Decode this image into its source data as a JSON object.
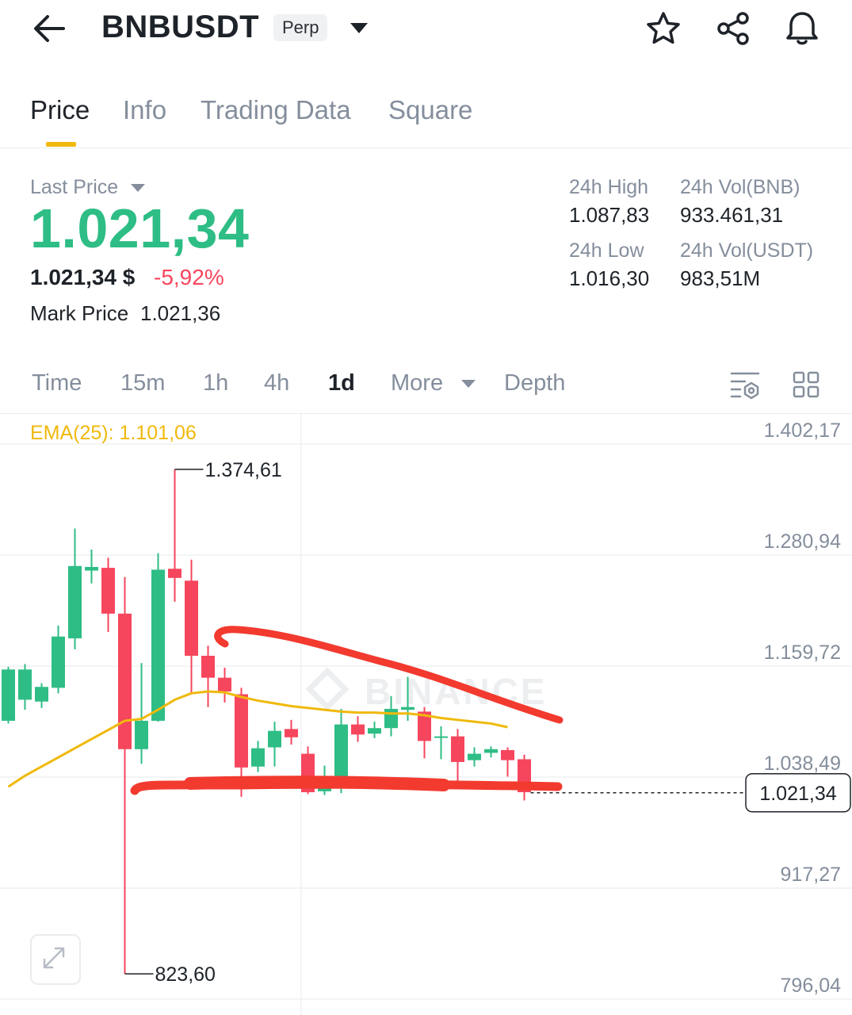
{
  "header": {
    "symbol": "BNBUSDT",
    "badge": "Perp",
    "icons": [
      "back-arrow-icon",
      "chevron-down-icon",
      "star-icon",
      "share-icon",
      "bell-icon"
    ]
  },
  "tabs": [
    {
      "label": "Price",
      "active": true
    },
    {
      "label": "Info"
    },
    {
      "label": "Trading Data"
    },
    {
      "label": "Square"
    }
  ],
  "price": {
    "last_price_label": "Last Price",
    "last_price": "1.021,34",
    "usd_value": "1.021,34 $",
    "change_pct": "-5,92%",
    "mark_price_label": "Mark Price",
    "mark_price": "1.021,36"
  },
  "stats": {
    "high_label": "24h High",
    "high": "1.087,83",
    "low_label": "24h Low",
    "low": "1.016,30",
    "vol_bnb_label": "24h Vol(BNB)",
    "vol_bnb": "933.461,31",
    "vol_usdt_label": "24h Vol(USDT)",
    "vol_usdt": "983,51M"
  },
  "timeframes": [
    "Time",
    "15m",
    "1h",
    "4h",
    "1d",
    "More",
    "Depth"
  ],
  "active_timeframe": "1d",
  "colors": {
    "up": "#2ebd85",
    "down": "#f6465d",
    "ema": "#f0b90b",
    "annotation": "#f23a2f",
    "accent": "#f0b90b"
  },
  "chart_data": {
    "type": "candlestick",
    "indicator_label": "EMA(25): 1.101,06",
    "y_ticks": [
      "1.402,17",
      "1.280,94",
      "1.159,72",
      "1.038,49",
      "917,27",
      "796,04"
    ],
    "ylim": [
      796.04,
      1402.17
    ],
    "current_price_label": "1.021,34",
    "current_price": 1021.34,
    "max_label": "1.374,61",
    "max_value": 1374.61,
    "min_label": "823,60",
    "min_value": 823.6,
    "watermark": "BINANCE",
    "candles": [
      {
        "o": 1100,
        "c": 1156,
        "h": 1159,
        "l": 1097
      },
      {
        "o": 1123,
        "c": 1156,
        "h": 1162,
        "l": 1112
      },
      {
        "o": 1121,
        "c": 1137,
        "h": 1141,
        "l": 1114
      },
      {
        "o": 1136,
        "c": 1192,
        "h": 1204,
        "l": 1130
      },
      {
        "o": 1190,
        "c": 1269,
        "h": 1310,
        "l": 1178
      },
      {
        "o": 1264,
        "c": 1268,
        "h": 1287,
        "l": 1250
      },
      {
        "o": 1267,
        "c": 1217,
        "h": 1278,
        "l": 1197
      },
      {
        "o": 1217,
        "c": 1069,
        "h": 1257,
        "l": 823.6
      },
      {
        "o": 1069,
        "c": 1100,
        "h": 1163,
        "l": 1053
      },
      {
        "o": 1100,
        "c": 1265,
        "h": 1283,
        "l": 1099
      },
      {
        "o": 1266,
        "c": 1256,
        "h": 1374.61,
        "l": 1230
      },
      {
        "o": 1253,
        "c": 1171,
        "h": 1276,
        "l": 1129
      },
      {
        "o": 1171,
        "c": 1147,
        "h": 1182,
        "l": 1115
      },
      {
        "o": 1147,
        "c": 1132,
        "h": 1158,
        "l": 1120
      },
      {
        "o": 1129,
        "c": 1049,
        "h": 1136,
        "l": 1017
      },
      {
        "o": 1050,
        "c": 1070,
        "h": 1078,
        "l": 1044
      },
      {
        "o": 1071,
        "c": 1089,
        "h": 1099,
        "l": 1050
      },
      {
        "o": 1091,
        "c": 1082,
        "h": 1101,
        "l": 1074
      },
      {
        "o": 1064,
        "c": 1022,
        "h": 1072,
        "l": 1020
      },
      {
        "o": 1023,
        "c": 1037,
        "h": 1051,
        "l": 1019
      },
      {
        "o": 1037,
        "c": 1096,
        "h": 1113,
        "l": 1021
      },
      {
        "o": 1096,
        "c": 1085,
        "h": 1105,
        "l": 1077
      },
      {
        "o": 1086,
        "c": 1092,
        "h": 1099,
        "l": 1081
      },
      {
        "o": 1092,
        "c": 1113,
        "h": 1127,
        "l": 1083
      },
      {
        "o": 1112,
        "c": 1115,
        "h": 1148,
        "l": 1100
      },
      {
        "o": 1110,
        "c": 1078,
        "h": 1115,
        "l": 1059
      },
      {
        "o": 1082,
        "c": 1083,
        "h": 1094,
        "l": 1058
      },
      {
        "o": 1083,
        "c": 1055,
        "h": 1091,
        "l": 1030
      },
      {
        "o": 1057,
        "c": 1064,
        "h": 1071,
        "l": 1050
      },
      {
        "o": 1065,
        "c": 1069,
        "h": 1072,
        "l": 1060
      },
      {
        "o": 1068,
        "c": 1057,
        "h": 1071,
        "l": 1039
      },
      {
        "o": 1058,
        "c": 1022,
        "h": 1063,
        "l": 1013
      }
    ],
    "ema_values": [
      1028,
      1040,
      1050,
      1060,
      1070,
      1080,
      1090,
      1100,
      1102,
      1112,
      1123,
      1130,
      1132,
      1131,
      1126,
      1122,
      1119,
      1116,
      1114,
      1112,
      1110,
      1109,
      1109,
      1108,
      1108,
      1106,
      1103,
      1101,
      1099,
      1097,
      1093
    ]
  }
}
